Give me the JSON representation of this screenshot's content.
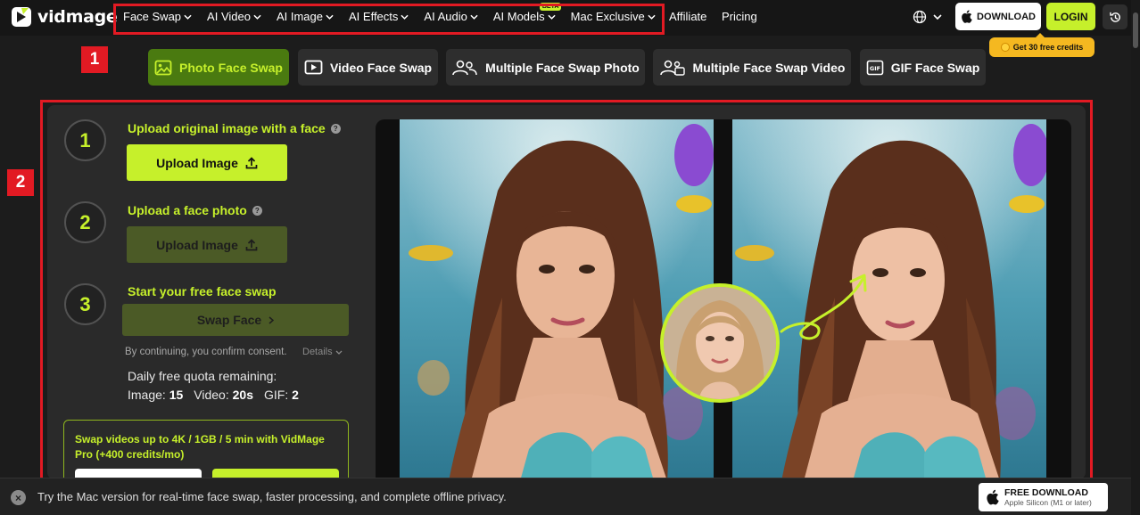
{
  "brand": {
    "name": "vidmage"
  },
  "nav": {
    "items": [
      {
        "label": "Face Swap"
      },
      {
        "label": "AI Video"
      },
      {
        "label": "AI Image"
      },
      {
        "label": "AI Effects"
      },
      {
        "label": "AI Audio"
      },
      {
        "label": "AI Models",
        "badge": "BETA"
      },
      {
        "label": "Mac Exclusive"
      }
    ],
    "affiliate": "Affiliate",
    "pricing": "Pricing",
    "download_label": "DOWNLOAD",
    "login_label": "LOGIN",
    "credits_label": "Get 30 free credits"
  },
  "annotations": {
    "label1": "1",
    "label2": "2"
  },
  "tabs": [
    {
      "label": "Photo Face Swap",
      "active": true
    },
    {
      "label": "Video Face Swap"
    },
    {
      "label": "Multiple Face Swap Photo"
    },
    {
      "label": "Multiple Face Swap Video"
    },
    {
      "label": "GIF Face Swap"
    }
  ],
  "steps": {
    "step1": {
      "number": "1",
      "title": "Upload original image with a face",
      "button": "Upload Image"
    },
    "step2": {
      "number": "2",
      "title": "Upload a face photo",
      "button": "Upload Image"
    },
    "step3": {
      "number": "3",
      "title": "Start your free face swap",
      "button": "Swap Face"
    }
  },
  "consent": {
    "text": "By continuing, you confirm consent.",
    "details": "Details"
  },
  "quota": {
    "title": "Daily free quota remaining:",
    "image_label": "Image:",
    "image_value": "15",
    "video_label": "Video:",
    "video_value": "20s",
    "gif_label": "GIF:",
    "gif_value": "2"
  },
  "pro": {
    "text": "Swap videos up to 4K / 1GB / 5 min with VidMage Pro (+400 credits/mo)"
  },
  "footer": {
    "text": "Try the Mac version for real-time face swap, faster processing, and complete offline privacy.",
    "download_title": "FREE DOWNLOAD",
    "download_sub": "Apple Silicon (M1 or later)"
  },
  "colors": {
    "accent": "#c6f02b",
    "annotation": "#e21a23",
    "background": "#1c1c1c"
  }
}
